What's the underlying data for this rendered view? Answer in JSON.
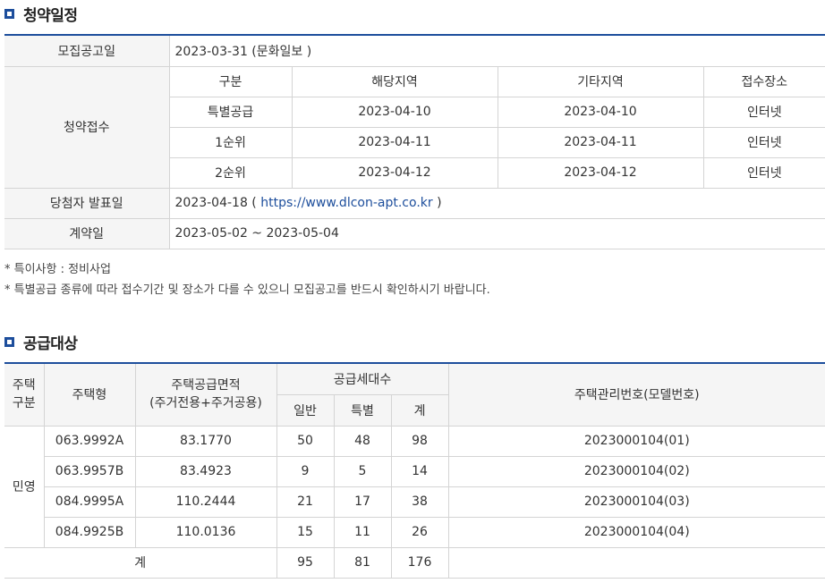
{
  "schedule": {
    "title": "청약일정",
    "notice_label": "모집공고일",
    "notice_value": "2023-03-31 (문화일보 )",
    "reception_label": "청약접수",
    "reception_headers": [
      "구분",
      "해당지역",
      "기타지역",
      "접수장소"
    ],
    "reception_rows": [
      [
        "특별공급",
        "2023-04-10",
        "2023-04-10",
        "인터넷"
      ],
      [
        "1순위",
        "2023-04-11",
        "2023-04-11",
        "인터넷"
      ],
      [
        "2순위",
        "2023-04-12",
        "2023-04-12",
        "인터넷"
      ]
    ],
    "announce_label": "당첨자 발표일",
    "announce_date": "2023-04-18 (",
    "announce_link": "https://www.dlcon-apt.co.kr",
    "announce_close": ")",
    "contract_label": "계약일",
    "contract_value": "2023-05-02 ~ 2023-05-04"
  },
  "notes": [
    "* 특이사항 : 정비사업",
    "* 특별공급 종류에 따라 접수기간 및 장소가 다를 수 있으니 모집공고를 반드시 확인하시기 바랍니다."
  ],
  "supply": {
    "title": "공급대상",
    "headers": {
      "house_type_group": "주택\n구분",
      "house_type": "주택형",
      "area": "주택공급면적\n(주거전용+주거공용)",
      "units": "공급세대수",
      "general": "일반",
      "special": "특별",
      "total": "계",
      "model_no": "주택관리번호(모델번호)"
    },
    "group": "민영",
    "rows": [
      [
        "063.9992A",
        "83.1770",
        "50",
        "48",
        "98",
        "2023000104(01)"
      ],
      [
        "063.9957B",
        "83.4923",
        "9",
        "5",
        "14",
        "2023000104(02)"
      ],
      [
        "084.9995A",
        "110.2444",
        "21",
        "17",
        "38",
        "2023000104(03)"
      ],
      [
        "084.9925B",
        "110.0136",
        "15",
        "11",
        "26",
        "2023000104(04)"
      ]
    ],
    "total_label": "계",
    "total_values": [
      "95",
      "81",
      "176"
    ]
  },
  "colors": {
    "accent": "#1d4e9c",
    "header_bg": "#f5f5f5",
    "border": "#d4d4d4"
  }
}
